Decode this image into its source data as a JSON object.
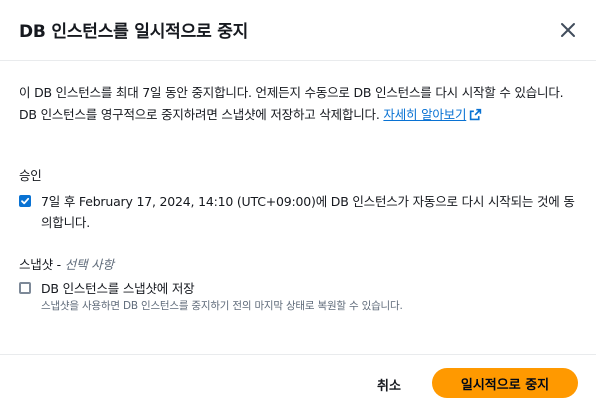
{
  "modal": {
    "title": "DB 인스턴스를 일시적으로 중지",
    "close_icon": "close-icon"
  },
  "description": {
    "text": "이 DB 인스턴스를 최대 7일 동안 중지합니다. 언제든지 수동으로 DB 인스턴스를 다시 시작할 수 있습니다. DB 인스턴스를 영구적으로 중지하려면 스냅샷에 저장하고 삭제합니다. ",
    "link_label": "자세히 알아보기",
    "link_icon": "external-link-icon"
  },
  "acknowledgement": {
    "label": "승인",
    "checkbox_text": "7일 후 February 17, 2024, 14:10 (UTC+09:00)에 DB 인스턴스가 자동으로 다시 시작되는 것에 동의합니다.",
    "checked": true
  },
  "snapshot": {
    "label": "스냅샷 - ",
    "optional_label": "선택 사항",
    "checkbox_text": "DB 인스턴스를 스냅샷에 저장",
    "checkbox_description": "스냅샷을 사용하면 DB 인스턴스를 중지하기 전의 마지막 상태로 복원할 수 있습니다.",
    "checked": false
  },
  "footer": {
    "cancel_label": "취소",
    "confirm_label": "일시적으로 중지"
  },
  "colors": {
    "primary": "#ff9900",
    "link": "#0972d3",
    "checkbox_checked": "#0972d3"
  }
}
